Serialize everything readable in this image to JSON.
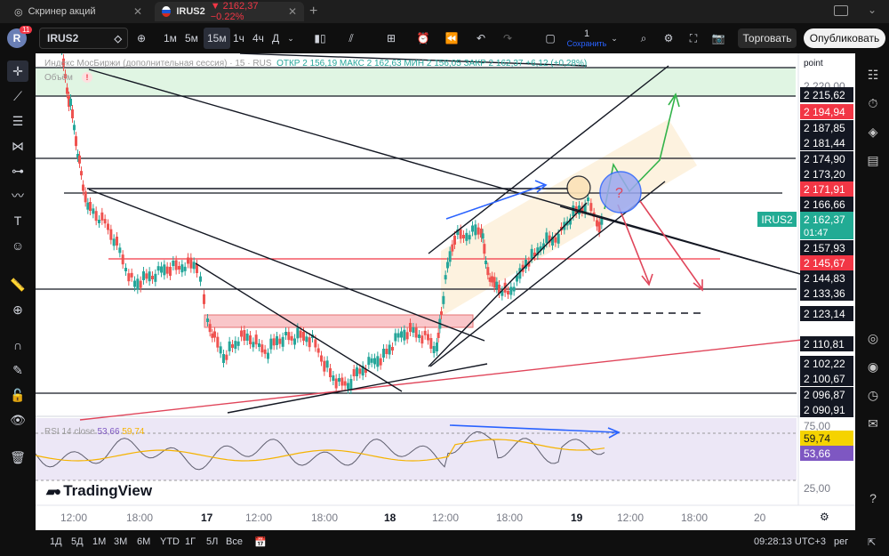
{
  "browser": {
    "tab1_title": "Скринер акций",
    "tab2_title": "IRUS2",
    "tab2_change": "▼ 2162,37 −0.22%",
    "new_tab": "+"
  },
  "toolbar": {
    "avatar_letter": "R",
    "avatar_badge": "11",
    "symbol": "IRUS2",
    "intervals": [
      "1м",
      "5м",
      "15м",
      "1ч",
      "4ч",
      "Д"
    ],
    "active_interval": "15м",
    "save_count": "1",
    "save_label": "Сохранить",
    "trade_label": "Торговать",
    "publish_label": "Опубликовать"
  },
  "legend": {
    "title": "Индекс МосБиржи (дополнительная сессия) · 15 · RUS",
    "ohlc": "ОТКР 2 156,19  МАКС 2 162,63  МИН 2 156,05  ЗАКР 2 162,37  +6,12 (+0,28%)",
    "volume": "Объём",
    "rsi_name": "RSI 14 close",
    "rsi_value": "53,66",
    "rsi_ma": "59,74"
  },
  "price_axis": {
    "point_label": "point",
    "symbol_badge": "IRUS2",
    "current_price": "2 162,37",
    "countdown": "01:47",
    "labels": [
      {
        "text": "2 220,00",
        "style": "plain"
      },
      {
        "text": "2 215,62",
        "style": "box"
      },
      {
        "text": "2 194,94",
        "style": "red"
      },
      {
        "text": "2 187,85",
        "style": "box"
      },
      {
        "text": "2 181,44",
        "style": "box"
      },
      {
        "text": "2 174,90",
        "style": "box"
      },
      {
        "text": "2 173,20",
        "style": "box"
      },
      {
        "text": "2 171,91",
        "style": "red"
      },
      {
        "text": "2 166,66",
        "style": "box"
      },
      {
        "text": "2 157,93",
        "style": "box"
      },
      {
        "text": "2 145,67",
        "style": "red"
      },
      {
        "text": "2 144,83",
        "style": "box"
      },
      {
        "text": "2 133,36",
        "style": "box"
      },
      {
        "text": "2 123,14",
        "style": "box"
      },
      {
        "text": "2 110,81",
        "style": "box"
      },
      {
        "text": "2 102,22",
        "style": "box"
      },
      {
        "text": "2 100,67",
        "style": "box"
      },
      {
        "text": "2 096,87",
        "style": "box"
      },
      {
        "text": "2 090,91",
        "style": "box"
      }
    ],
    "rsi_labels": [
      {
        "text": "75,00",
        "style": "plain"
      },
      {
        "text": "59,74",
        "style": "yellow"
      },
      {
        "text": "53,66",
        "style": "purple"
      },
      {
        "text": "25,00",
        "style": "plain"
      }
    ]
  },
  "time_axis": [
    "12:00",
    "18:00",
    "17",
    "12:00",
    "18:00",
    "18",
    "12:00",
    "18:00",
    "19",
    "12:00",
    "18:00",
    "20"
  ],
  "annotations": {
    "question_mark": "?"
  },
  "branding": {
    "logo_text": "TradingView"
  },
  "bottom": {
    "ranges": [
      "1Д",
      "5Д",
      "1М",
      "3М",
      "6М",
      "YTD",
      "1Г",
      "5Л",
      "Все"
    ],
    "clock": "09:28:13 UTC+3",
    "session": "рег"
  },
  "colors": {
    "up": "#26a69a",
    "down": "#ef5350",
    "accent": "#2962ff",
    "level_red": "#f23645",
    "zone_green": "#d8f2dc",
    "zone_pink": "#f9c6c9",
    "zone_orange": "#fdf1dc",
    "rsi_bg": "#ece7f6"
  },
  "icons": {
    "left_tools": [
      "crosshair-icon",
      "trend-line-icon",
      "fib-icon",
      "pattern-icon",
      "prediction-icon",
      "brush-icon",
      "text-icon",
      "emoji-icon",
      "ruler-icon",
      "zoom-icon",
      "magnet-icon",
      "lock-drawing-icon",
      "lock-icon",
      "eye-icon",
      "trash-icon"
    ],
    "right_tools": [
      "watchlist-icon",
      "alerts-icon",
      "layers-icon",
      "hotlist-icon",
      "calendar-icon",
      "ideas-icon",
      "clock-icon",
      "chat-icon",
      "help-icon"
    ]
  }
}
